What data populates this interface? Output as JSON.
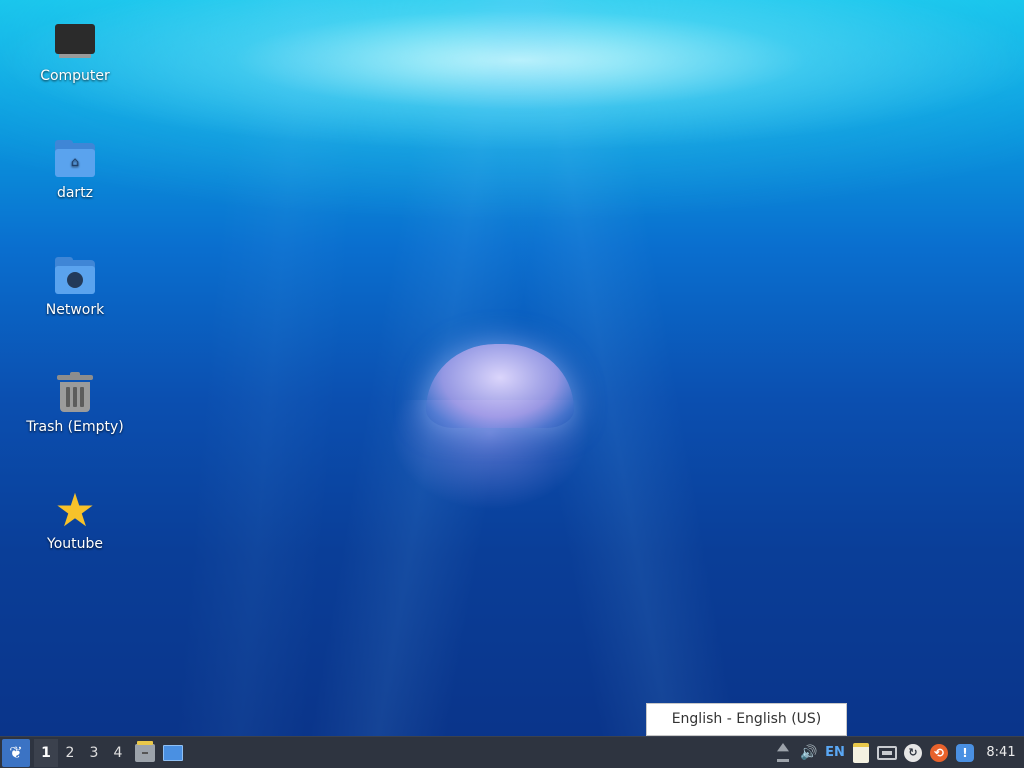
{
  "desktop": {
    "icons": [
      {
        "label": "Computer",
        "icon": "computer-icon"
      },
      {
        "label": "dartz",
        "icon": "home-folder-icon"
      },
      {
        "label": "Network",
        "icon": "network-folder-icon"
      },
      {
        "label": "Trash (Empty)",
        "icon": "trash-icon"
      },
      {
        "label": "Youtube",
        "icon": "star-icon"
      }
    ]
  },
  "tooltip": {
    "text": "English - English (US)"
  },
  "taskbar": {
    "menu_icon": "lxqt-menu-icon",
    "workspaces": [
      "1",
      "2",
      "3",
      "4"
    ],
    "active_workspace": "1",
    "launchers": [
      "file-manager-icon",
      "show-desktop-icon"
    ],
    "tray": {
      "eject_icon": "eject-icon",
      "volume_icon": "volume-icon",
      "volume_glyph": "🔊",
      "keyboard_layout": "EN",
      "clipboard_icon": "clipboard-icon",
      "network_icon": "network-monitor-icon",
      "update_icon": "update-icon",
      "update_glyph": "↻",
      "ubuntu_icon": "ubuntu-updates-icon",
      "ubuntu_glyph": "⟲",
      "notification_icon": "notification-icon",
      "notification_glyph": "!",
      "clock": "8:41"
    }
  },
  "colors": {
    "taskbar_bg": "#2e3440",
    "accent": "#3b73c4",
    "keyboard_layout": "#5aa8f5"
  }
}
